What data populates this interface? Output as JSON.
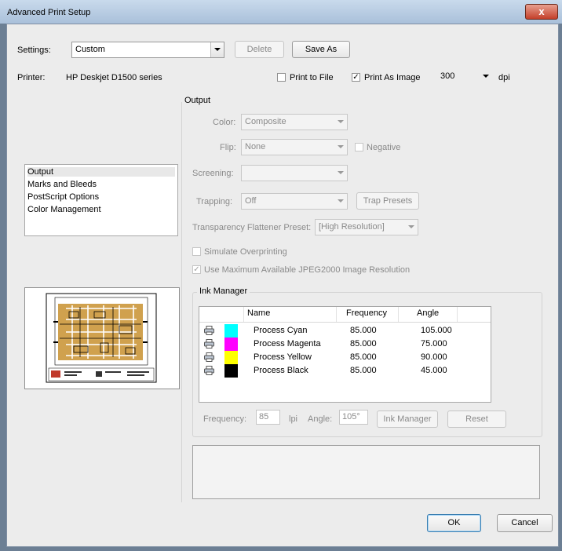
{
  "window": {
    "title": "Advanced Print Setup",
    "close_glyph": "x"
  },
  "settings": {
    "label": "Settings:",
    "value": "Custom",
    "delete_label": "Delete",
    "save_as_label": "Save As"
  },
  "printer": {
    "label": "Printer:",
    "name": "HP Deskjet D1500 series",
    "print_to_file": "Print to File",
    "print_to_file_checked": false,
    "print_as_image": "Print As Image",
    "print_as_image_checked": true,
    "dpi_value": "300",
    "dpi_label": "dpi"
  },
  "nav": {
    "items": [
      "Output",
      "Marks and Bleeds",
      "PostScript Options",
      "Color Management"
    ],
    "selected": 0
  },
  "output": {
    "group_label": "Output",
    "color_label": "Color:",
    "color_value": "Composite",
    "flip_label": "Flip:",
    "flip_value": "None",
    "negative_label": "Negative",
    "screening_label": "Screening:",
    "screening_value": "",
    "trapping_label": "Trapping:",
    "trapping_value": "Off",
    "trap_presets_label": "Trap Presets",
    "flattener_label": "Transparency Flattener Preset:",
    "flattener_value": "[High Resolution]",
    "simulate_overprinting": "Simulate Overprinting",
    "use_jpeg2000": "Use Maximum Available JPEG2000 Image Resolution",
    "check_glyph": "✓"
  },
  "ink_manager": {
    "group_label": "Ink Manager",
    "columns": [
      "Name",
      "Frequency",
      "Angle"
    ],
    "rows": [
      {
        "name": "Process Cyan",
        "frequency": "85.000",
        "angle": "105.000",
        "color": "#00ffff"
      },
      {
        "name": "Process Magenta",
        "frequency": "85.000",
        "angle": "75.000",
        "color": "#ff00ff"
      },
      {
        "name": "Process Yellow",
        "frequency": "85.000",
        "angle": "90.000",
        "color": "#ffff00"
      },
      {
        "name": "Process Black",
        "frequency": "85.000",
        "angle": "45.000",
        "color": "#000000"
      }
    ],
    "frequency_label": "Frequency:",
    "frequency_value": "85",
    "lpi_label": "lpi",
    "angle_label": "Angle:",
    "angle_value": "105°",
    "ink_manager_button": "Ink Manager",
    "reset_button": "Reset"
  },
  "footer": {
    "ok_label": "OK",
    "cancel_label": "Cancel"
  }
}
